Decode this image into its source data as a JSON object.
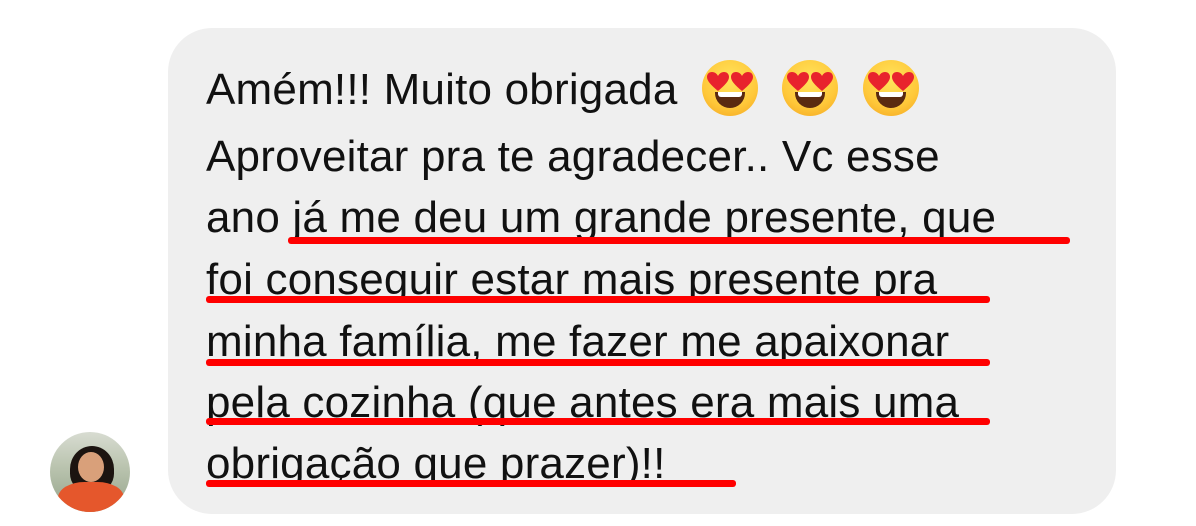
{
  "message": {
    "lines": [
      "Amém!!! Muito obrigada",
      "Aproveitar pra te agradecer.. Vc esse",
      "ano já me deu um grande presente, que",
      "foi conseguir estar mais presente pra",
      "minha família, me fazer me apaixonar",
      "pela cozinha (que antes era mais uma",
      "obrigação que prazer)!!"
    ],
    "emojis": [
      "heart-eyes",
      "heart-eyes",
      "heart-eyes"
    ]
  },
  "colors": {
    "bubble": "#efefef",
    "underline": "#ff0000",
    "text": "#111111"
  }
}
